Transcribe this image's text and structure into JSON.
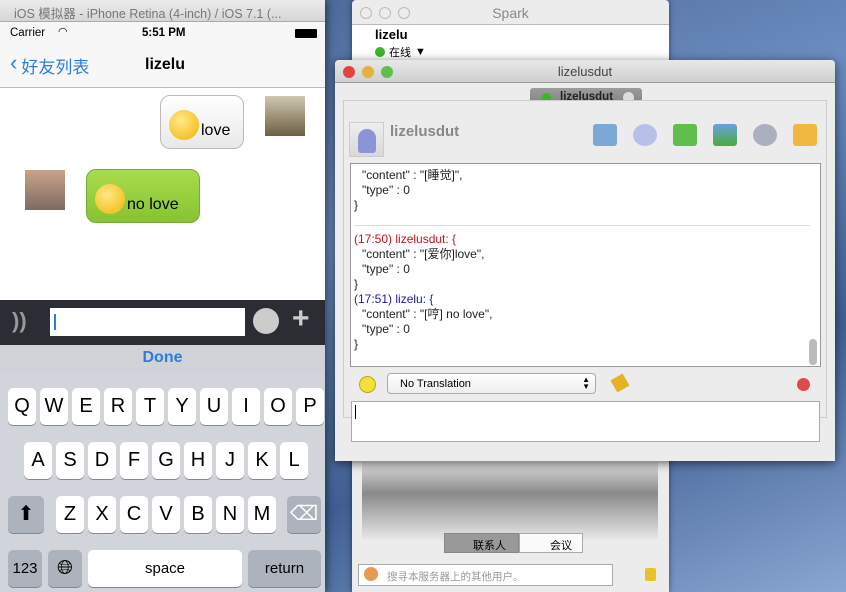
{
  "simulator": {
    "window_title": "iOS 模拟器 - iPhone Retina (4-inch) / iOS 7.1 (...",
    "carrier": "Carrier",
    "time": "5:51 PM",
    "back_label": "好友列表",
    "nav_title": "lizelu",
    "messages": [
      {
        "side": "right",
        "text": "love",
        "emoji": "kiss-heart"
      },
      {
        "side": "left",
        "text": "no love",
        "emoji": "angry"
      }
    ],
    "done_label": "Done",
    "keyboard": {
      "row1": [
        "Q",
        "W",
        "E",
        "R",
        "T",
        "Y",
        "U",
        "I",
        "O",
        "P"
      ],
      "row2": [
        "A",
        "S",
        "D",
        "F",
        "G",
        "H",
        "J",
        "K",
        "L"
      ],
      "row3": [
        "Z",
        "X",
        "C",
        "V",
        "B",
        "N",
        "M"
      ],
      "numbers": "123",
      "space": "space",
      "return": "return"
    }
  },
  "spark": {
    "window_title": "Spark",
    "username": "lizelu",
    "status": "在线",
    "tabs": [
      "联系人",
      "会议"
    ],
    "search_placeholder": "搜寻本服务器上的其他用户。"
  },
  "chat_window": {
    "title": "lizelusdut",
    "tab_label": "lizelusdut",
    "contact_name": "lizelusdut",
    "transcript": {
      "prev_lines": [
        "\"content\" : \"[睡觉]\",",
        "\"type\" : 0",
        "}"
      ],
      "entries": [
        {
          "header": "(17:50) lizelusdut: {",
          "color": "#c0141e",
          "lines": [
            "\"content\" : \"[爱你]love\",",
            "\"type\" : 0",
            "}"
          ]
        },
        {
          "header": "(17:51) lizelu: {",
          "color": "#1b1ba0",
          "lines": [
            "\"content\" : \"[哼] no love\",",
            "\"type\" : 0",
            "}"
          ]
        }
      ]
    },
    "translation_select": "No Translation"
  }
}
